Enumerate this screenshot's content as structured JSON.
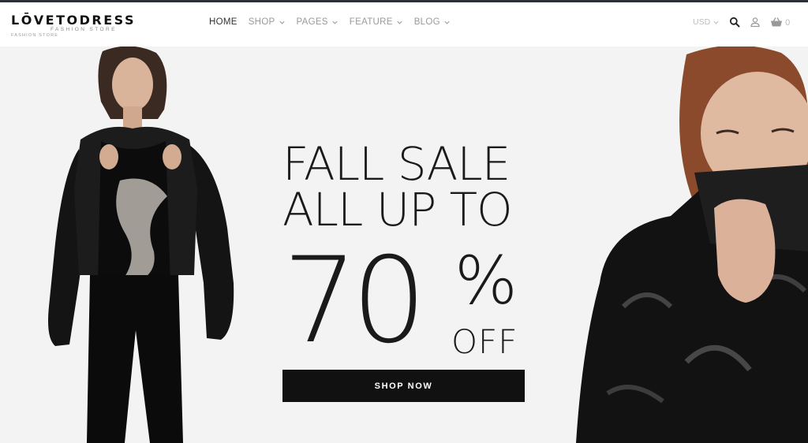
{
  "header": {
    "logo_text": "LŌVETODRESS",
    "logo_tagline": "FASHION STORE",
    "logo_tagline_small": "FASHION STORE",
    "nav": [
      {
        "label": "HOME",
        "active": true
      },
      {
        "label": "SHOP",
        "dropdown": true
      },
      {
        "label": "PAGES",
        "dropdown": true
      },
      {
        "label": "FEATURE",
        "dropdown": true
      },
      {
        "label": "BLOG",
        "dropdown": true
      }
    ],
    "currency": "USD",
    "cart_count": "0",
    "icons": [
      "search-icon",
      "user-icon",
      "basket-icon"
    ]
  },
  "hero": {
    "line1": "FALL SALE",
    "line2": "ALL UP TO",
    "big_number": "70",
    "percent": "%",
    "off": "OFF",
    "button_label": "SHOP NOW"
  },
  "colors": {
    "topline": "#2c2f33",
    "hero_bg": "#f3f3f3",
    "button_bg": "#111111",
    "nav_active": "#333333",
    "nav_inactive": "#9a9a9a"
  }
}
